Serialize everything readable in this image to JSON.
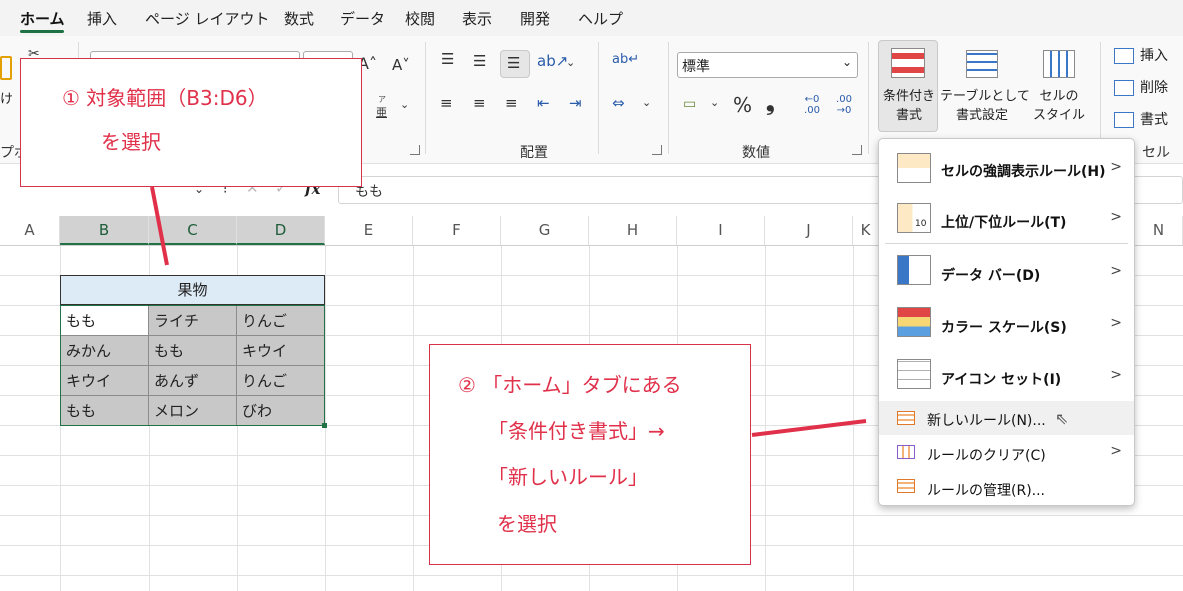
{
  "tabs": [
    "ホーム",
    "挿入",
    "ページ レイアウト",
    "数式",
    "データ",
    "校閲",
    "表示",
    "開発",
    "ヘルプ"
  ],
  "ribbon": {
    "clipboard_frag_1": "け",
    "clipboard_frag_2": "プボ",
    "alignment_label": "配置",
    "number_label": "数値",
    "cells_label": "セル",
    "number_format": "標準",
    "percent": "%",
    "comma": "❟",
    "conditional_format_l1": "条件付き",
    "conditional_format_l2": "書式",
    "format_table_l1": "テーブルとして",
    "format_table_l2": "書式設定",
    "cell_style_l1": "セルの",
    "cell_style_l2": "スタイル",
    "insert": "挿入",
    "delete": "削除",
    "format": "書式",
    "furigana": "亜",
    "furigana_small": "ア",
    "dec_inc": "←0 .00",
    "dec_dec": ".00 →0"
  },
  "formula": {
    "fx": "fx",
    "value": "もも"
  },
  "columns": [
    "A",
    "B",
    "C",
    "D",
    "E",
    "F",
    "G",
    "H",
    "I",
    "J",
    "K",
    "N"
  ],
  "table": {
    "header": "果物",
    "rows": [
      [
        "もも",
        "ライチ",
        "りんご"
      ],
      [
        "みかん",
        "もも",
        "キウイ"
      ],
      [
        "キウイ",
        "あんず",
        "りんご"
      ],
      [
        "もも",
        "メロン",
        "びわ"
      ]
    ]
  },
  "callout1": {
    "line1": "① 対象範囲（B3:D6）",
    "line2": "を選択"
  },
  "callout2": {
    "line1": "② 「ホーム」タブにある",
    "line2": "「条件付き書式」→",
    "line3": "「新しいルール」",
    "line4": "を選択"
  },
  "menu": {
    "highlight_rules": "セルの強調表示ルール(H)",
    "top_bottom": "上位/下位ルール(T)",
    "data_bar": "データ バー(D)",
    "color_scale": "カラー スケール(S)",
    "icon_set": "アイコン セット(I)",
    "new_rule": "新しいルール(N)...",
    "clear_rules": "ルールのクリア(C)",
    "manage_rules": "ルールの管理(R)...",
    "icon_10": "10"
  },
  "colors": {
    "accent_green": "#217346",
    "callout_red": "#e0304a"
  }
}
